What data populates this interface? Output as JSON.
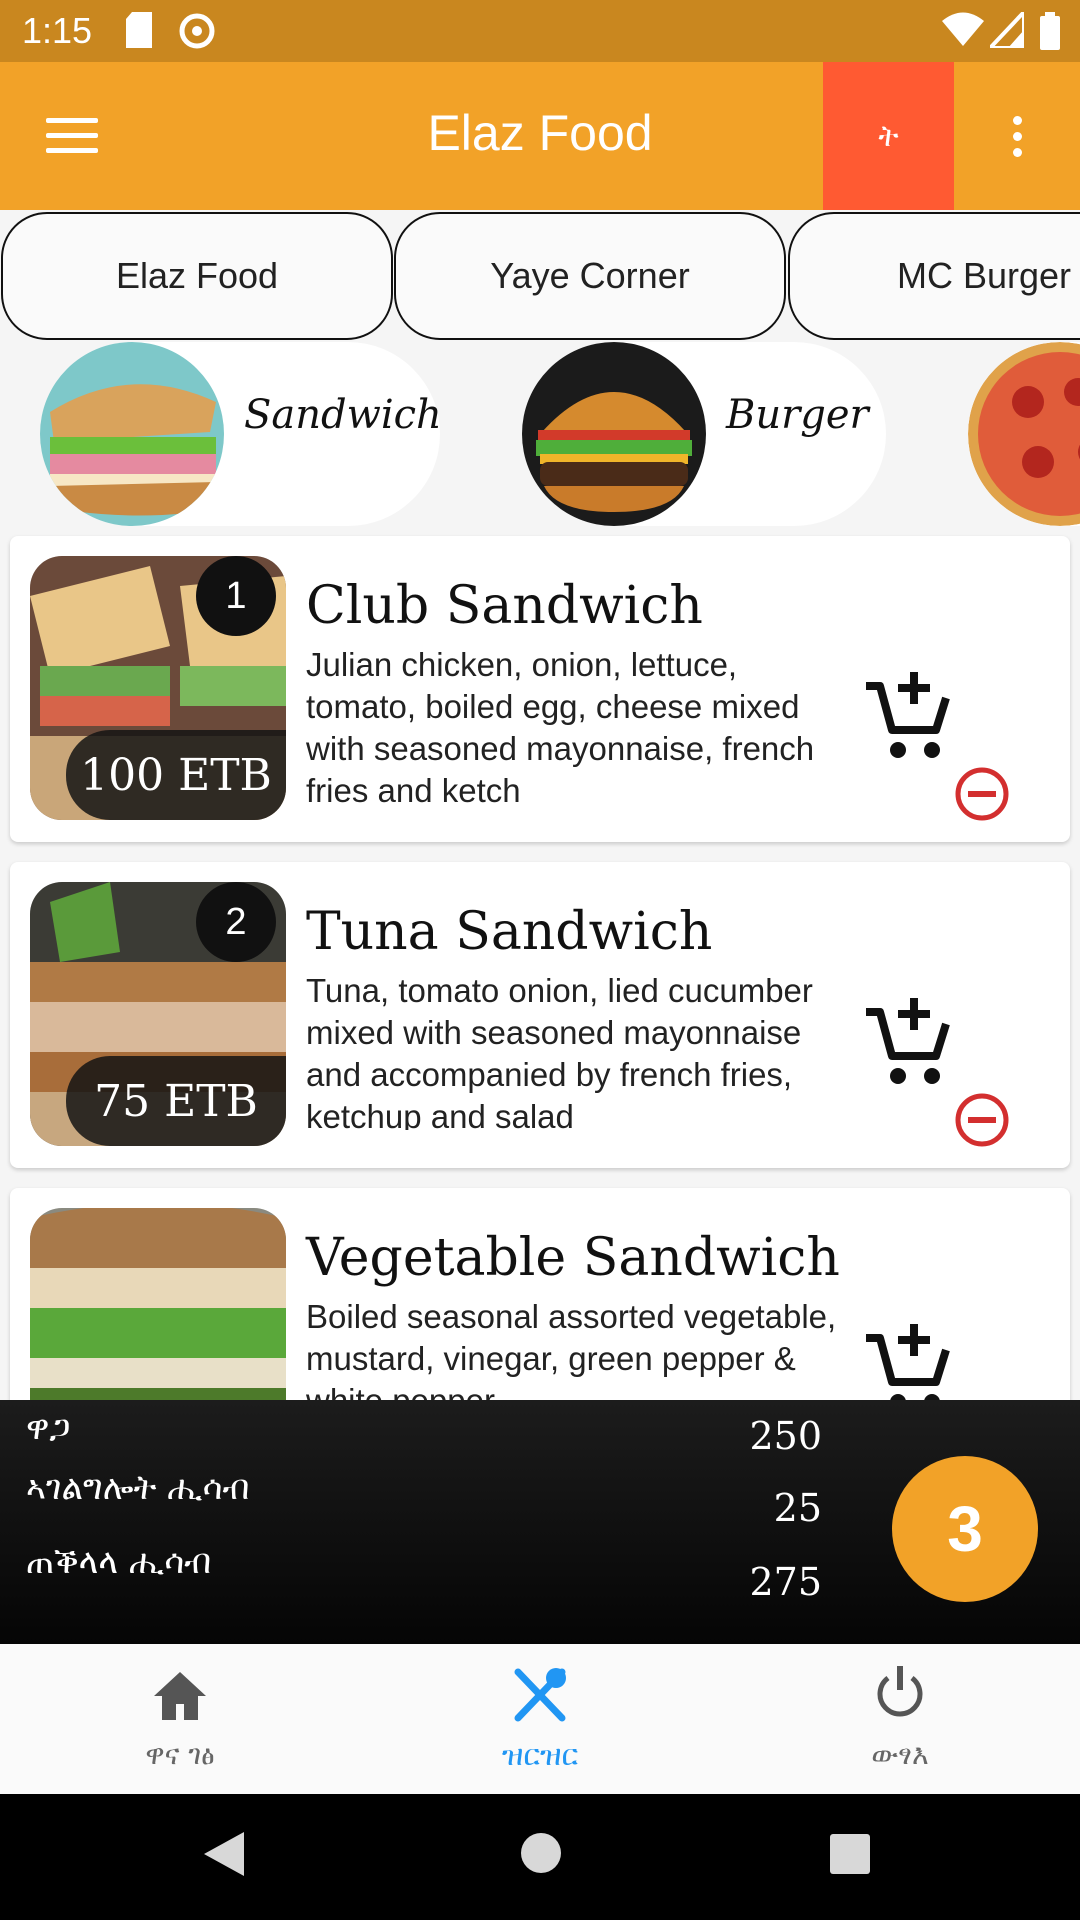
{
  "status_bar": {
    "time": "1:15"
  },
  "app_bar": {
    "title": "Elaz Food",
    "language_label": "ት"
  },
  "restaurants": [
    {
      "label": "Elaz Food"
    },
    {
      "label": "Yaye Corner"
    },
    {
      "label": "MC Burger"
    }
  ],
  "categories": [
    {
      "label": "Sandwich"
    },
    {
      "label": "Burger"
    }
  ],
  "menu_items": [
    {
      "number": "1",
      "name": "Club Sandwich",
      "price": "100 ETB",
      "description": "Julian chicken, onion, lettuce, tomato, boiled egg, cheese mixed with seasoned mayonnaise, french fries and ketch"
    },
    {
      "number": "2",
      "name": "Tuna Sandwich",
      "price": "75 ETB",
      "description": "Tuna, tomato onion, lied cucumber mixed with seasoned mayonnaise and accompanied by french fries, ketchup and salad"
    },
    {
      "number": "",
      "name": "Vegetable Sandwich",
      "price": "",
      "description": "Boiled seasonal assorted vegetable, mustard, vinegar, green pepper & white pepper"
    }
  ],
  "totals": {
    "price_label": "ዋጋ",
    "price_value": "250",
    "service_label": "ኣገልግሎት ሒሳብ",
    "service_value": "25",
    "total_label": "ጠቕላላ ሒሳብ",
    "total_value": "275",
    "cart_count": "3"
  },
  "bottom_nav": [
    {
      "label": "ዋና ገፅ"
    },
    {
      "label": "ዝርዝር"
    },
    {
      "label": "ውፃእ"
    }
  ],
  "colors": {
    "app_bar": "#f2a228",
    "status_bar": "#c9871f",
    "language_button": "#ff5a32",
    "active_nav": "#2196f3",
    "remove_icon": "#d32f2f"
  }
}
